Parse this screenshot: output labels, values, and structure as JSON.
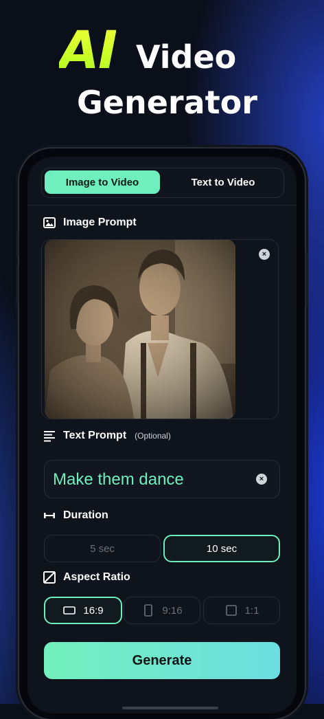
{
  "hero": {
    "ai": "AI",
    "video": "Video",
    "generator": "Generator"
  },
  "tabs": [
    {
      "label": "Image to Video",
      "active": true
    },
    {
      "label": "Text to Video",
      "active": false
    }
  ],
  "image_prompt": {
    "label": "Image Prompt",
    "icon": "image-icon"
  },
  "text_prompt": {
    "label": "Text Prompt",
    "optional": "(Optional)",
    "value": "Make them dance",
    "icon": "text-lines-icon"
  },
  "duration": {
    "label": "Duration",
    "icon": "duration-icon",
    "options": [
      "5 sec",
      "10 sec"
    ],
    "selected": "10 sec"
  },
  "aspect_ratio": {
    "label": "Aspect Ratio",
    "icon": "aspect-ratio-icon",
    "options": [
      "16:9",
      "9:16",
      "1:1"
    ],
    "selected": "16:9"
  },
  "generate": {
    "label": "Generate"
  },
  "colors": {
    "accent": "#6eefbd",
    "accent_gradient_end": "#6cdde0",
    "ai_yellow": "#e8ff2f",
    "background": "#0b0f1a",
    "screen": "#0f131b",
    "glow_blue": "#2846dc"
  }
}
